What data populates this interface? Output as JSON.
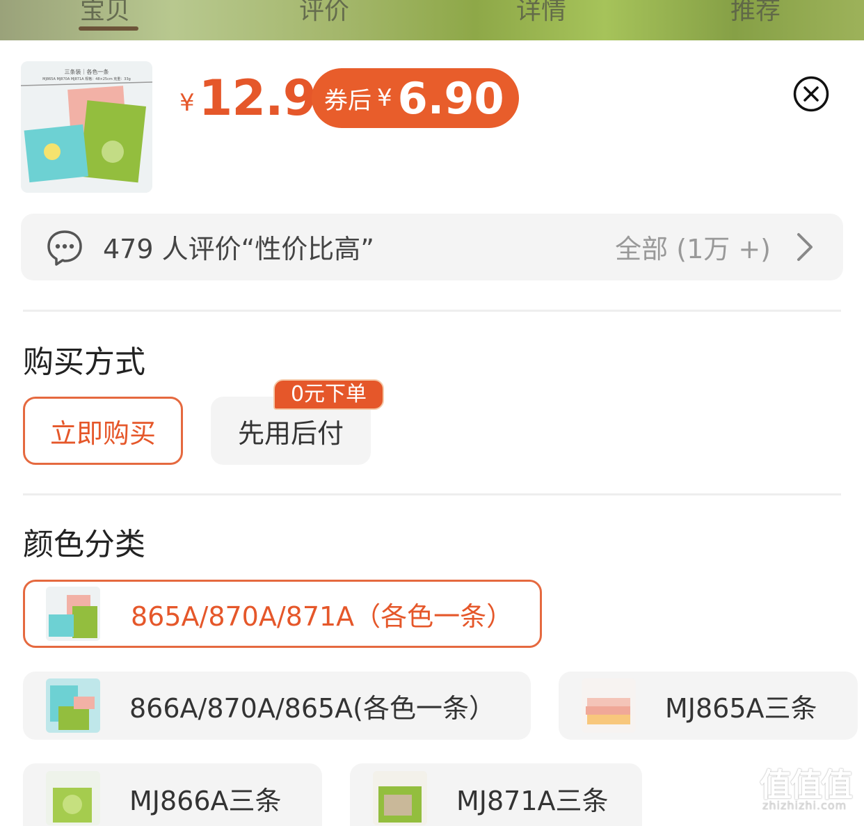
{
  "header": {
    "tabs": [
      "宝贝",
      "评价",
      "详情",
      "推荐"
    ],
    "active_tab": "宝贝"
  },
  "price": {
    "currency": "¥",
    "original": "12.9",
    "coupon_label": "券后",
    "coupon_currency": "¥",
    "coupon_price": "6.90"
  },
  "thumb": {
    "line1": "三条装｜各色一条",
    "line2": "MJ865A MJ870A MJ871A  规格：48×25cm  克重：33g"
  },
  "review": {
    "summary": "479 人评价“性价比高”",
    "all_label": "全部 (1万 +)"
  },
  "purchase": {
    "title": "购买方式",
    "options": [
      {
        "label": "立即购买",
        "selected": true
      },
      {
        "label": "先用后付",
        "selected": false,
        "badge": "0元下单"
      }
    ]
  },
  "color": {
    "title": "颜色分类",
    "options": [
      {
        "label": "865A/870A/871A（各色一条）",
        "selected": true
      },
      {
        "label": "866A/870A/865A(各色一条）",
        "selected": false
      },
      {
        "label": "MJ865A三条",
        "selected": false
      },
      {
        "label": "MJ866A三条",
        "selected": false
      },
      {
        "label": "MJ871A三条",
        "selected": false
      }
    ]
  },
  "watermark": {
    "main": "值值值",
    "sub": "zhizhizhi.com"
  },
  "colors": {
    "accent": "#e5572a",
    "pill": "#e85d2b",
    "option_bg": "#f4f4f4"
  }
}
